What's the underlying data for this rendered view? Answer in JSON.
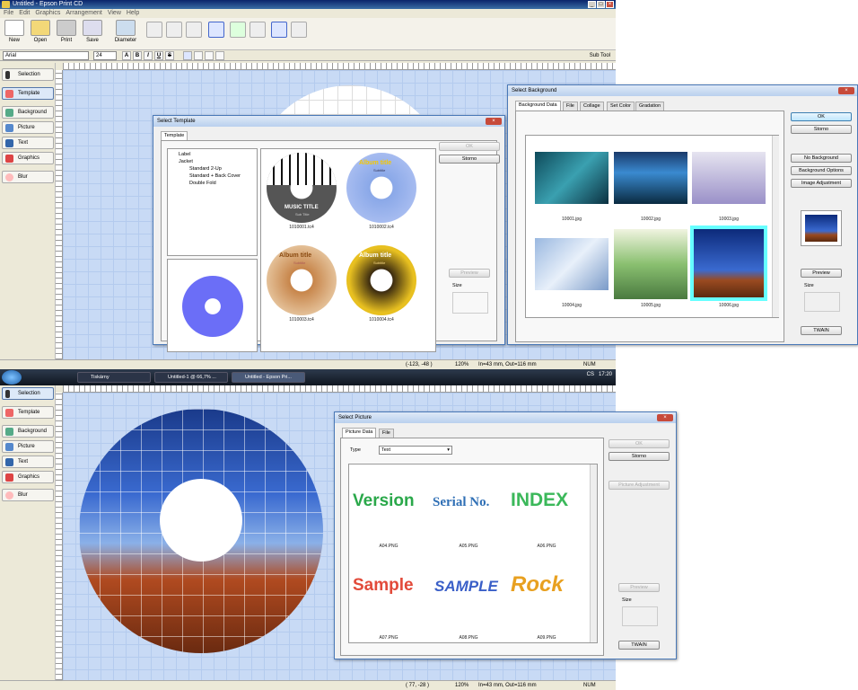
{
  "top_window": {
    "title": "Untitled - Epson Print CD",
    "menu": [
      "File",
      "Edit",
      "Graphics",
      "Arrangement",
      "View",
      "Help"
    ],
    "toolbar": {
      "new": "New",
      "open": "Open",
      "print": "Print",
      "save": "Save",
      "diameter": "Diameter"
    },
    "font": "Arial",
    "font_size": "24",
    "format_buttons": [
      "A",
      "B",
      "I",
      "U",
      "S"
    ],
    "sub_tool": "Sub Tool",
    "left_buttons": [
      "Selection",
      "Template",
      "Background",
      "Picture",
      "Text",
      "Graphics",
      "Blur"
    ],
    "status": {
      "coords": "(-123, -48 )",
      "zoom": "120%",
      "size": "In=43 mm, Out=116 mm",
      "num": "NUM"
    }
  },
  "select_template": {
    "title": "Select Template",
    "tab": "Template",
    "tree": [
      "Label",
      "Jacket",
      "Standard 2-Up",
      "Standard + Back Cover",
      "Double Fold"
    ],
    "items": [
      {
        "file": "1010001.tc4",
        "disc_text": "MUSIC TITLE",
        "disc_sub": "Sub Title"
      },
      {
        "file": "1010002.tc4",
        "disc_text": "Album title",
        "disc_sub": "Subtitle"
      },
      {
        "file": "1010003.tc4",
        "disc_text": "Album title",
        "disc_sub": "Subtitle"
      },
      {
        "file": "1010004.tc4",
        "disc_text": "Album title",
        "disc_sub": "Subtitle"
      }
    ],
    "ok": "OK",
    "storno": "Storno",
    "preview": "Preview",
    "size": "Size"
  },
  "select_background": {
    "title": "Select Background",
    "tabs": [
      "Background Data",
      "File",
      "Collage",
      "Set Color",
      "Gradation"
    ],
    "items": [
      "10001.jpg",
      "10002.jpg",
      "10003.jpg",
      "10004.jpg",
      "10005.jpg",
      "10006.jpg"
    ],
    "ok": "OK",
    "storno": "Storno",
    "no_background": "No Background",
    "background_options": "Background Options",
    "image_adjustment": "Image Adjustment",
    "preview": "Preview",
    "size": "Size",
    "twain": "TWAIN"
  },
  "taskbar": {
    "items": [
      "Tiskárny",
      "Untitled-1 @ 66,7% ...",
      "Untitled - Epson Pri..."
    ],
    "lang": "CS",
    "time": "17:20"
  },
  "bottom_window": {
    "left_buttons": [
      "Selection",
      "Template",
      "Background",
      "Picture",
      "Text",
      "Graphics",
      "Blur"
    ],
    "status": {
      "coords": "( 77, -28 )",
      "zoom": "120%",
      "size": "In=43 mm, Out=116 mm",
      "num": "NUM"
    }
  },
  "select_picture": {
    "title": "Select Picture",
    "tabs": [
      "Picture Data",
      "File"
    ],
    "type_label": "Type",
    "type_value": "Text",
    "items": [
      {
        "text": "Version",
        "file": "A04.PNG",
        "color": "#2aa84a"
      },
      {
        "text": "Serial No.",
        "file": "A05.PNG",
        "color": "#2f6fb5"
      },
      {
        "text": "INDEX",
        "file": "A06.PNG",
        "color": "#3bb85a"
      },
      {
        "text": "Sample",
        "file": "A07.PNG",
        "color": "#e24a3a"
      },
      {
        "text": "SAMPLE",
        "file": "A08.PNG",
        "color": "#3a5fc8"
      },
      {
        "text": "Rock",
        "file": "A09.PNG",
        "color": "#e8a020"
      }
    ],
    "ok": "OK",
    "storno": "Storno",
    "picture_adjustment": "Picture Adjustment",
    "preview": "Preview",
    "size": "Size",
    "twain": "TWAIN"
  }
}
